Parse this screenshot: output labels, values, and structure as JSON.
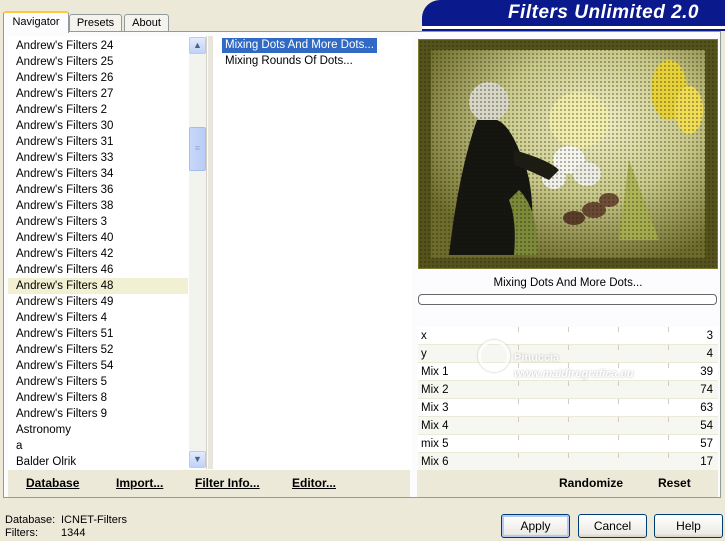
{
  "window": {
    "title": "Filters Unlimited 2.0"
  },
  "tabs": [
    {
      "label": "Navigator",
      "active": true
    },
    {
      "label": "Presets",
      "active": false
    },
    {
      "label": "About",
      "active": false
    }
  ],
  "categories": {
    "items": [
      "Andrew's Filters 24",
      "Andrew's Filters 25",
      "Andrew's Filters 26",
      "Andrew's Filters 27",
      "Andrew's Filters 2",
      "Andrew's Filters 30",
      "Andrew's Filters 31",
      "Andrew's Filters 33",
      "Andrew's Filters 34",
      "Andrew's Filters 36",
      "Andrew's Filters 38",
      "Andrew's Filters 3",
      "Andrew's Filters 40",
      "Andrew's Filters 42",
      "Andrew's Filters 46",
      "Andrew's Filters 48",
      "Andrew's Filters 49",
      "Andrew's Filters 4",
      "Andrew's Filters 51",
      "Andrew's Filters 52",
      "Andrew's Filters 54",
      "Andrew's Filters 5",
      "Andrew's Filters 8",
      "Andrew's Filters 9",
      "Astronomy",
      "a",
      "Balder Olrik"
    ],
    "selected_index": 15
  },
  "filters": {
    "items": [
      "Mixing Dots And More Dots...",
      "Mixing Rounds Of Dots..."
    ],
    "selected_index": 0
  },
  "preview": {
    "filter_label": "Mixing Dots And More Dots..."
  },
  "params": [
    {
      "name": "x",
      "value": "3"
    },
    {
      "name": "y",
      "value": "4"
    },
    {
      "name": "Mix 1",
      "value": "39"
    },
    {
      "name": "Mix 2",
      "value": "74"
    },
    {
      "name": "Mix 3",
      "value": "63"
    },
    {
      "name": "Mix 4",
      "value": "54"
    },
    {
      "name": "mix 5",
      "value": "57"
    },
    {
      "name": "Mix 6",
      "value": "17"
    }
  ],
  "watermark": {
    "line1": "Pinuccia",
    "line2": "www.maidiregrafica.eu"
  },
  "actions": {
    "database": "Database",
    "import": "Import...",
    "filter_info": "Filter Info...",
    "editor": "Editor...",
    "randomize": "Randomize",
    "reset": "Reset"
  },
  "footer": {
    "database_label": "Database:",
    "database_value": "ICNET-Filters",
    "filters_label": "Filters:",
    "filters_value": "1344"
  },
  "buttons": {
    "apply": "Apply",
    "cancel": "Cancel",
    "help": "Help"
  },
  "colors": {
    "title_banner": "#0A1A8C",
    "selection": "#316AC5",
    "dialog_bg": "#ECE9D8"
  }
}
